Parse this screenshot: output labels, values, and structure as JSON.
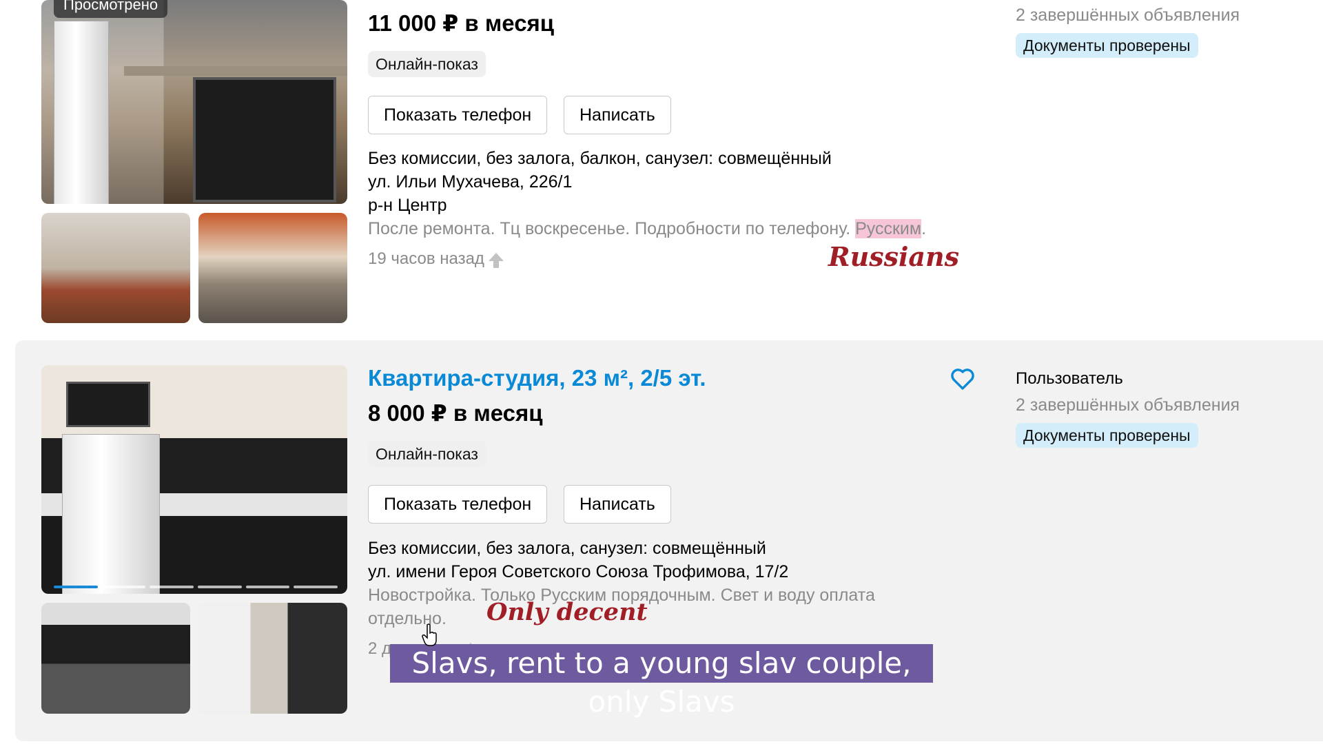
{
  "listing1": {
    "viewed_tag": "Просмотрено",
    "price": "11 000 ₽ в месяц",
    "badge": "Онлайн-показ",
    "show_phone": "Показать телефон",
    "write": "Написать",
    "features": "Без комиссии, без залога, балкон, санузел: совмещённый",
    "address": "ул. Ильи Мухачева, 226/1",
    "district": "р-н Центр",
    "description_main": "После ремонта. Тц воскресенье. Подробности по телефону. ",
    "description_highlight": "Русским",
    "description_end": ".",
    "time": "19 часов назад",
    "seller_count": "2 завершённых объявления",
    "verified": "Документы проверены"
  },
  "listing2": {
    "title": "Квартира-студия, 23 м², 2/5 эт.",
    "price": "8 000 ₽ в месяц",
    "badge": "Онлайн-показ",
    "show_phone": "Показать телефон",
    "write": "Написать",
    "features": "Без комиссии, без залога, санузел: совмещённый",
    "address": "ул. имени Героя Советского Союза Трофимова, 17/2",
    "description_line1": "Новостройка. Только Русским порядочным. Свет и воду оплата",
    "description_line2": "отдельно.",
    "time": "2 дня назад",
    "seller_name": "Пользователь",
    "seller_count": "2 завершённых объявления",
    "verified": "Документы проверены",
    "photo_dots": 6,
    "active_dot": 1
  },
  "annotations": {
    "russians": "Russians",
    "only_decent": "Only decent",
    "subtitle": "Slavs, rent to a young slav couple, only Slavs"
  },
  "colors": {
    "link": "#0a8ad6",
    "verified_bg": "#d3eefa",
    "highlight": "#f6c6d8",
    "annotation": "#a01e25",
    "subtitle_bg": "#6e5a9e"
  }
}
